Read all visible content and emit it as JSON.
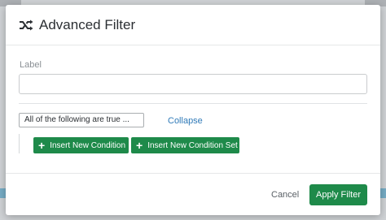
{
  "modal": {
    "title": "Advanced Filter",
    "title_icon": "shuffle-icon",
    "label_field": {
      "label": "Label",
      "value": "",
      "placeholder": ""
    },
    "condition_mode": "All of the following are true ...",
    "collapse_label": "Collapse",
    "insert_condition_label": "Insert New Condition",
    "insert_condition_set_label": "Insert New Condition Set",
    "cancel_label": "Cancel",
    "apply_label": "Apply Filter"
  },
  "colors": {
    "primary_green": "#1e8a4a",
    "link_blue": "#2f7ab8"
  }
}
